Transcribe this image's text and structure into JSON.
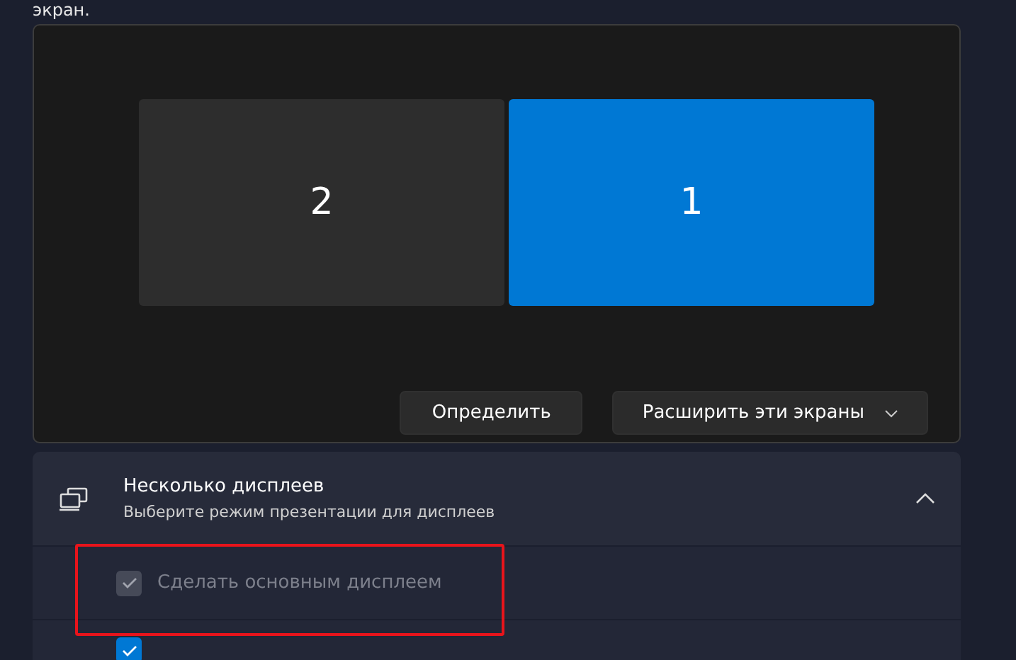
{
  "intro_text": "экран.",
  "monitors": [
    {
      "label": "2",
      "selected": false
    },
    {
      "label": "1",
      "selected": true
    }
  ],
  "identify_button": "Определить",
  "mode_dropdown": {
    "value": "Расширить эти экраны"
  },
  "multiple_displays": {
    "title": "Несколько дисплеев",
    "subtitle": "Выберите режим презентации для дисплеев",
    "expanded": true,
    "options": [
      {
        "label": "Сделать основным дисплеем",
        "checked": true,
        "disabled": true
      },
      {
        "checked": true,
        "disabled": false
      }
    ]
  }
}
